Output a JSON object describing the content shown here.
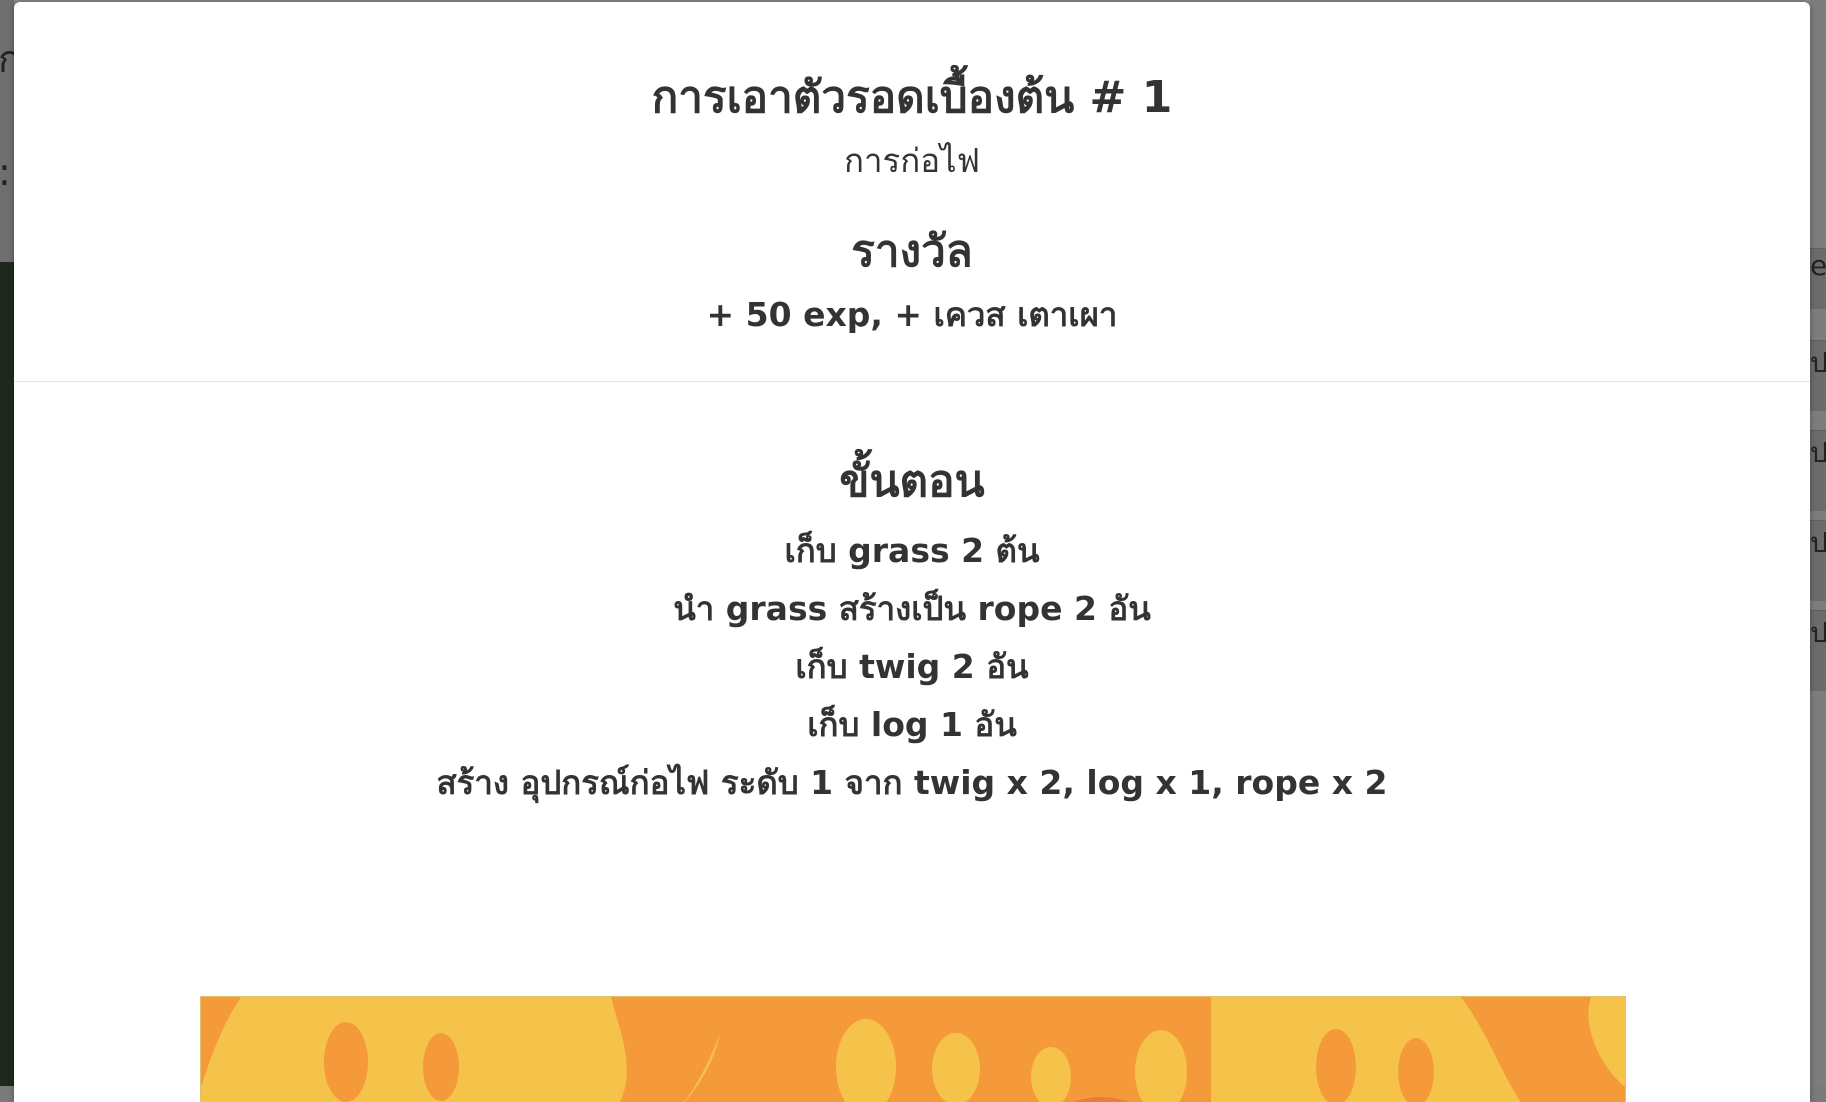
{
  "background": {
    "left_char_top": "ก",
    "left_char_mid": ":",
    "right_char_top": "e",
    "right_row_char": "ป"
  },
  "modal": {
    "title": "การเอาตัวรอดเบื้องต้น # 1",
    "subtitle": "การก่อไฟ",
    "reward_heading": "รางวัล",
    "reward_text": "+ 50 exp, + เควส เตาเผา",
    "steps_heading": "ขั้นตอน",
    "steps": [
      "เก็บ grass 2 ต้น",
      "นำ grass สร้างเป็น rope 2 อัน",
      "เก็บ twig 2 อัน",
      "เก็บ log 1 อัน",
      "สร้าง อุปกรณ์ก่อไฟ ระดับ 1 จาก twig x 2, log x 1, rope x 2"
    ]
  },
  "banner": {
    "image": "fire-pattern",
    "colors": {
      "light": "#f5c34a",
      "mid": "#f59a3a",
      "dark": "#ee7a3a"
    }
  }
}
